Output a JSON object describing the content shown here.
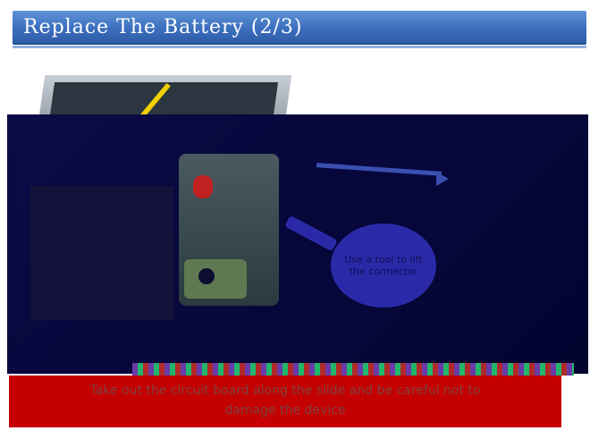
{
  "header": {
    "title": "Replace The Battery (2/3)"
  },
  "photo": {
    "callout_text": "Use a tool to lift the connector"
  },
  "caption": {
    "line1": "Take out the circuit board along the slide and be careful not to",
    "line2": "damage the device"
  },
  "colors": {
    "title_bar": "#3c6fbe",
    "caption_bg": "#c40000",
    "photo_bg": "#06063a"
  }
}
